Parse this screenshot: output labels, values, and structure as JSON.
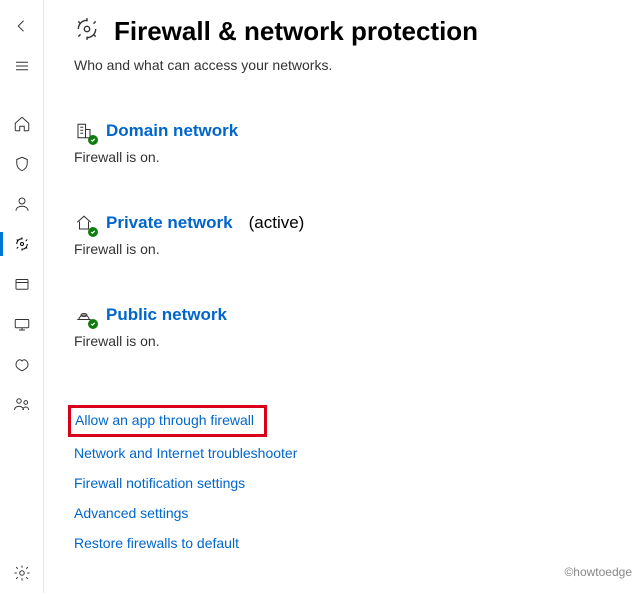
{
  "header": {
    "title": "Firewall & network protection",
    "subtitle": "Who and what can access your networks."
  },
  "sections": {
    "domain": {
      "label": "Domain network",
      "status": "Firewall is on."
    },
    "private": {
      "label": "Private network",
      "active_tag": "(active)",
      "status": "Firewall is on."
    },
    "public": {
      "label": "Public network",
      "status": "Firewall is on."
    }
  },
  "links": {
    "allow_app": "Allow an app through firewall",
    "troubleshooter": "Network and Internet troubleshooter",
    "notifications": "Firewall notification settings",
    "advanced": "Advanced settings",
    "restore": "Restore firewalls to default"
  },
  "watermark": "©howtoedge"
}
